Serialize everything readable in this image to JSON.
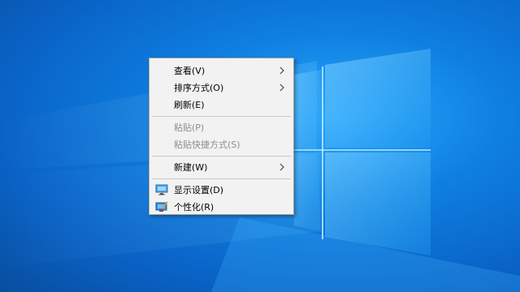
{
  "desktop": {
    "background_color": "#0a63c7",
    "accent_color": "#2aa6ff"
  },
  "context_menu": {
    "items": [
      {
        "label": "查看(V)",
        "has_submenu": true,
        "enabled": true
      },
      {
        "label": "排序方式(O)",
        "has_submenu": true,
        "enabled": true
      },
      {
        "label": "刷新(E)",
        "has_submenu": false,
        "enabled": true
      },
      {
        "label": "粘贴(P)",
        "has_submenu": false,
        "enabled": false
      },
      {
        "label": "粘贴快捷方式(S)",
        "has_submenu": false,
        "enabled": false
      },
      {
        "label": "新建(W)",
        "has_submenu": true,
        "enabled": true
      },
      {
        "label": "显示设置(D)",
        "has_submenu": false,
        "enabled": true,
        "icon": "display-settings-icon"
      },
      {
        "label": "个性化(R)",
        "has_submenu": false,
        "enabled": true,
        "icon": "personalize-icon"
      }
    ]
  }
}
